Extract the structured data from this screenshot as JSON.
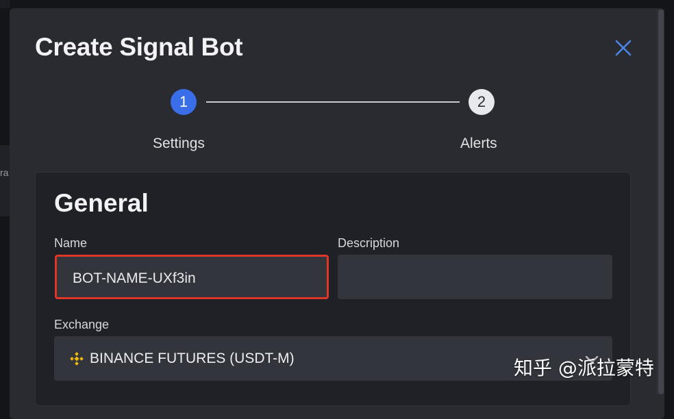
{
  "modal": {
    "title": "Create Signal Bot",
    "close_icon": "close-icon"
  },
  "stepper": {
    "steps": [
      {
        "number": "1",
        "label": "Settings",
        "state": "active",
        "color": "#3a6ee8"
      },
      {
        "number": "2",
        "label": "Alerts",
        "state": "inactive",
        "color": "#e8e9ec"
      }
    ]
  },
  "general": {
    "section_title": "General",
    "name": {
      "label": "Name",
      "value": "BOT-NAME-UXf3in",
      "highlight_color": "#e0362a"
    },
    "description": {
      "label": "Description",
      "value": ""
    },
    "exchange": {
      "label": "Exchange",
      "value": "BINANCE FUTURES (USDT-M)",
      "icon": "binance-icon",
      "icon_color": "#f0b90b"
    }
  },
  "backdrop": {
    "partial_text": "ra"
  },
  "watermark": {
    "text": "知乎 @派拉蒙特"
  }
}
